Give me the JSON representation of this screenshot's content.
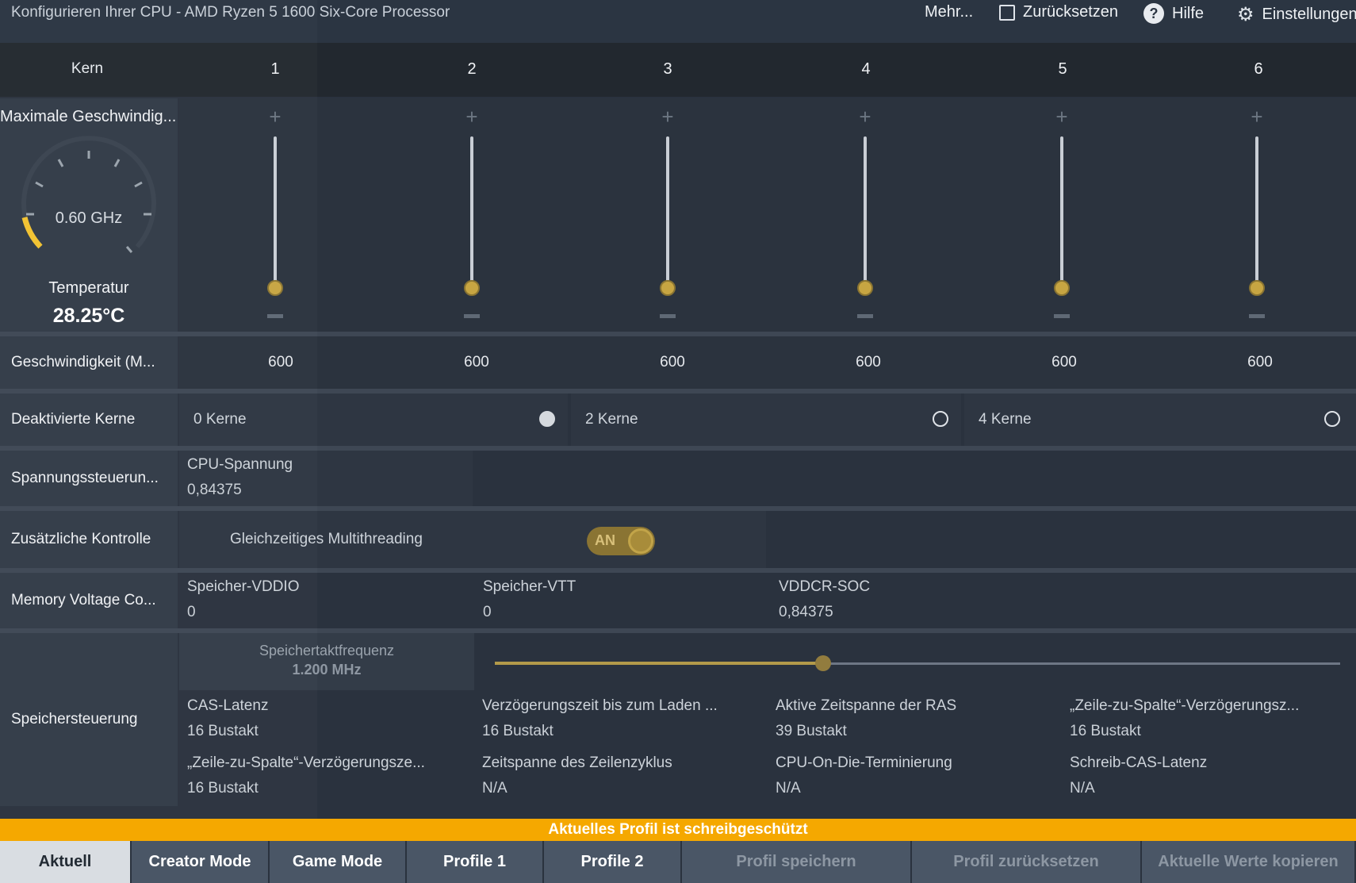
{
  "titlebar": {
    "title": "Konfigurieren Ihrer CPU - AMD Ryzen 5 1600 Six-Core Processor",
    "more": "Mehr...",
    "reset": "Zurücksetzen",
    "help": "Hilfe",
    "settings": "Einstellungen",
    "help_icon_glyph": "?"
  },
  "header": {
    "kern": "Kern",
    "cores": [
      "1",
      "2",
      "3",
      "4",
      "5",
      "6"
    ]
  },
  "max_speed": {
    "label": "Maximale Geschwindig...",
    "gauge_value": "0.60 GHz",
    "temp_label": "Temperatur",
    "temp_value": "28.25°C"
  },
  "sliders": {
    "plus": "+",
    "levels": [
      0,
      0,
      0,
      0,
      0,
      0
    ]
  },
  "speed": {
    "label": "Geschwindigkeit (M...",
    "values": [
      "600",
      "600",
      "600",
      "600",
      "600",
      "600"
    ]
  },
  "deactivated_cores": {
    "label": "Deaktivierte Kerne",
    "options": [
      {
        "label": "0 Kerne",
        "selected": true
      },
      {
        "label": "2 Kerne",
        "selected": false
      },
      {
        "label": "4 Kerne",
        "selected": false
      }
    ]
  },
  "voltage_control": {
    "label": "Spannungssteuerun...",
    "cpu_voltage_label": "CPU-Spannung",
    "cpu_voltage_value": "0,84375"
  },
  "additional_control": {
    "label": "Zusätzliche Kontrolle",
    "smt_label": "Gleichzeitiges Multithreading",
    "smt_state": "AN"
  },
  "memory_voltage": {
    "label": "Memory Voltage Co...",
    "items": [
      {
        "name": "Speicher-VDDIO",
        "value": "0"
      },
      {
        "name": "Speicher-VTT",
        "value": "0"
      },
      {
        "name": "VDDCR-SOC",
        "value": "0,84375"
      }
    ]
  },
  "memory_control": {
    "label": "Speichersteuerung",
    "clock_label": "Speichertaktfrequenz",
    "clock_value": "1.200 MHz",
    "clock_slider_fraction": 0.39,
    "timings": [
      {
        "name": "CAS-Latenz",
        "value": "16 Bustakt"
      },
      {
        "name": "Verzögerungszeit bis zum Laden ...",
        "value": "16 Bustakt"
      },
      {
        "name": "Aktive Zeitspanne der RAS",
        "value": "39 Bustakt"
      },
      {
        "name": "„Zeile-zu-Spalte“-Verzögerungsz...",
        "value": "16 Bustakt"
      },
      {
        "name": "„Zeile-zu-Spalte“-Verzögerungsze...",
        "value": "16 Bustakt"
      },
      {
        "name": "Zeitspanne des Zeilenzyklus",
        "value": "N/A"
      },
      {
        "name": "CPU-On-Die-Terminierung",
        "value": "N/A"
      },
      {
        "name": "Schreib-CAS-Latenz",
        "value": "N/A"
      }
    ]
  },
  "banner": "Aktuelles Profil ist schreibgeschützt",
  "tabs": [
    {
      "label": "Aktuell"
    },
    {
      "label": "Creator Mode"
    },
    {
      "label": "Game Mode"
    },
    {
      "label": "Profile 1"
    },
    {
      "label": "Profile 2"
    },
    {
      "label": "Profil speichern"
    },
    {
      "label": "Profil zurücksetzen"
    },
    {
      "label": "Aktuelle Werte kopieren"
    }
  ],
  "colors": {
    "accent_gold": "#c7a542",
    "banner_orange": "#f5a800",
    "gauge_arc": "#f2c230"
  }
}
